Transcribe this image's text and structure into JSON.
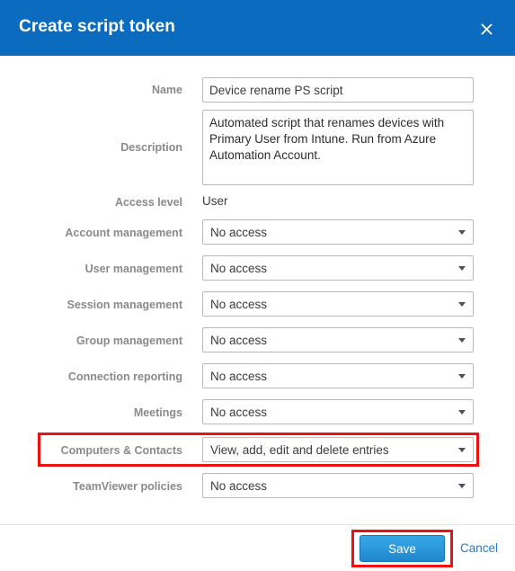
{
  "dialog": {
    "title": "Create script token",
    "close_icon": "close-icon"
  },
  "form": {
    "name": {
      "label": "Name",
      "value": "Device rename PS script",
      "placeholder": ""
    },
    "description": {
      "label": "Description",
      "value": "Automated script that renames devices with Primary User from Intune. Run from Azure Automation Account.",
      "placeholder": ""
    },
    "access_level": {
      "label": "Access level",
      "value": "User"
    },
    "permissions": [
      {
        "label": "Account management",
        "value": "No access"
      },
      {
        "label": "User management",
        "value": "No access"
      },
      {
        "label": "Session management",
        "value": "No access"
      },
      {
        "label": "Group management",
        "value": "No access"
      },
      {
        "label": "Connection reporting",
        "value": "No access"
      },
      {
        "label": "Meetings",
        "value": "No access"
      },
      {
        "label": "Computers & Contacts",
        "value": "View, add, edit and delete entries"
      },
      {
        "label": "TeamViewer policies",
        "value": "No access"
      }
    ]
  },
  "footer": {
    "save_label": "Save",
    "cancel_label": "Cancel"
  },
  "colors": {
    "header_blue": "#0b6cbf",
    "save_blue": "#2e9bdd",
    "link_blue": "#1f7ec4",
    "annotation_red": "#ee1111",
    "label_gray": "#8a8a8a"
  }
}
